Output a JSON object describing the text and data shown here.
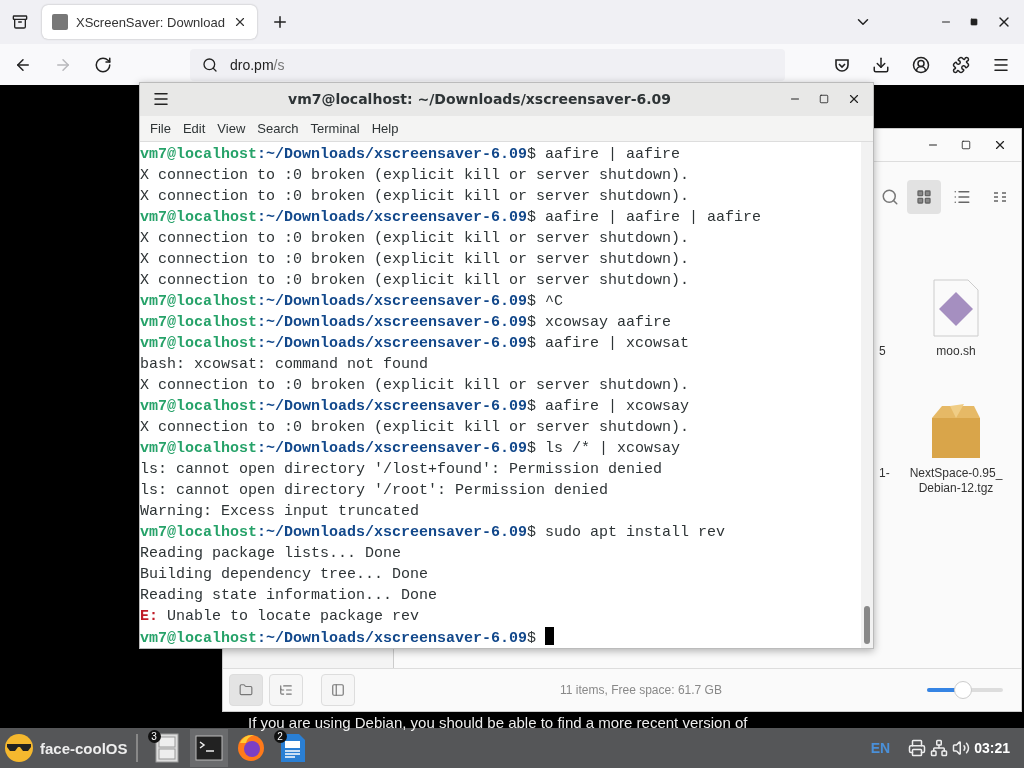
{
  "browser": {
    "tabs": [
      {
        "title": "XScreenSaver: Download",
        "selected": true
      }
    ],
    "nav_buttons": [
      {
        "kind": "back",
        "disabled": false
      },
      {
        "kind": "forward",
        "disabled": true
      },
      {
        "kind": "reload",
        "disabled": false
      }
    ],
    "url": {
      "host": "dro.pm",
      "path": "/s"
    }
  },
  "page_text": "If you are using Debian, you should be able to find a more recent version of",
  "file_manager": {
    "view_buttons": [
      {
        "kind": "grid",
        "selected": true
      },
      {
        "kind": "list",
        "selected": false
      },
      {
        "kind": "compact",
        "selected": false
      }
    ],
    "files": [
      {
        "name": "5",
        "kind": "partial"
      },
      {
        "name": "moo.sh",
        "kind": "script"
      },
      {
        "name": "1-",
        "kind": "partial"
      },
      {
        "name": "NextSpace-0.95_Debian-12.tgz",
        "kind": "archive"
      }
    ],
    "side_buttons": [
      {
        "kind": "places",
        "selected": true
      },
      {
        "kind": "tree",
        "selected": false
      },
      {
        "kind": "preview",
        "selected": false
      }
    ],
    "status": "11 items, Free space: 61.7 GB",
    "zoom": {
      "level": 0.48
    }
  },
  "terminal": {
    "title": "vm7@localhost: ~/Downloads/xscreensaver-6.09",
    "menu": [
      "File",
      "Edit",
      "View",
      "Search",
      "Terminal",
      "Help"
    ],
    "lines": [
      {
        "kind": "prompt",
        "user": "vm7@localhost",
        "path": ":~/Downloads/xscreensaver-6.09",
        "command": "$ aafire | aafire"
      },
      {
        "kind": "output",
        "text": "X connection to :0 broken (explicit kill or server shutdown)."
      },
      {
        "kind": "output",
        "text": "X connection to :0 broken (explicit kill or server shutdown)."
      },
      {
        "kind": "prompt",
        "user": "vm7@localhost",
        "path": ":~/Downloads/xscreensaver-6.09",
        "command": "$ aafire | aafire | aafire"
      },
      {
        "kind": "output",
        "text": "X connection to :0 broken (explicit kill or server shutdown)."
      },
      {
        "kind": "output",
        "text": "X connection to :0 broken (explicit kill or server shutdown)."
      },
      {
        "kind": "output",
        "text": "X connection to :0 broken (explicit kill or server shutdown)."
      },
      {
        "kind": "prompt",
        "user": "vm7@localhost",
        "path": ":~/Downloads/xscreensaver-6.09",
        "command": "$ ^C"
      },
      {
        "kind": "prompt",
        "user": "vm7@localhost",
        "path": ":~/Downloads/xscreensaver-6.09",
        "command": "$ xcowsay aafire"
      },
      {
        "kind": "prompt",
        "user": "vm7@localhost",
        "path": ":~/Downloads/xscreensaver-6.09",
        "command": "$ aafire | xcowsat"
      },
      {
        "kind": "output",
        "text": "bash: xcowsat: command not found"
      },
      {
        "kind": "output",
        "text": "X connection to :0 broken (explicit kill or server shutdown)."
      },
      {
        "kind": "prompt",
        "user": "vm7@localhost",
        "path": ":~/Downloads/xscreensaver-6.09",
        "command": "$ aafire | xcowsay"
      },
      {
        "kind": "output",
        "text": "X connection to :0 broken (explicit kill or server shutdown)."
      },
      {
        "kind": "prompt",
        "user": "vm7@localhost",
        "path": ":~/Downloads/xscreensaver-6.09",
        "command": "$ ls /* | xcowsay"
      },
      {
        "kind": "output",
        "text": "ls: cannot open directory '/lost+found': Permission denied"
      },
      {
        "kind": "output",
        "text": "ls: cannot open directory '/root': Permission denied"
      },
      {
        "kind": "output",
        "text": "Warning: Excess input truncated"
      },
      {
        "kind": "prompt",
        "user": "vm7@localhost",
        "path": ":~/Downloads/xscreensaver-6.09",
        "command": "$ sudo apt install rev"
      },
      {
        "kind": "output",
        "text": "Reading package lists... Done"
      },
      {
        "kind": "output",
        "text": "Building dependency tree... Done"
      },
      {
        "kind": "output",
        "text": "Reading state information... Done"
      },
      {
        "kind": "error",
        "prefix": "E:",
        "text": " Unable to locate package rev"
      },
      {
        "kind": "prompt",
        "user": "vm7@localhost",
        "path": ":~/Downloads/xscreensaver-6.09",
        "command": "$",
        "cursor": true
      }
    ]
  },
  "taskbar": {
    "start_label": "face-coolOS",
    "apps": [
      {
        "kind": "files",
        "badge": "3",
        "selected": false
      },
      {
        "kind": "terminal",
        "selected": true
      },
      {
        "kind": "browser",
        "selected": false
      },
      {
        "kind": "document",
        "badge": "2",
        "selected": false
      }
    ],
    "language": "EN",
    "clock": "03:21"
  }
}
